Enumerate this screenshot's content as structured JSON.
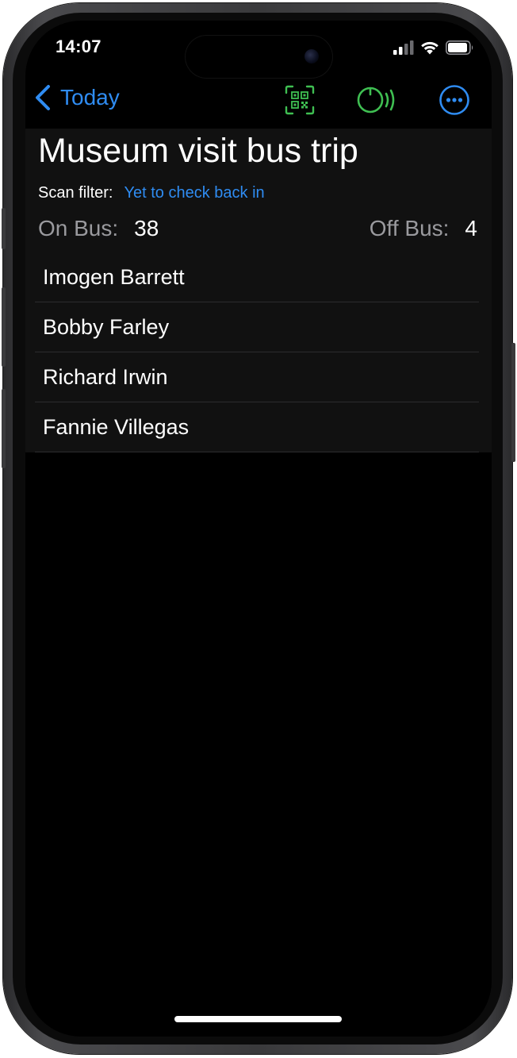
{
  "status_bar": {
    "time": "14:07"
  },
  "nav": {
    "back_label": "Today",
    "icons": [
      "chevron-left-icon",
      "qr-code-icon",
      "nfc-scan-icon",
      "more-icon"
    ],
    "colors": {
      "accent": "#2f8cf2",
      "scan": "#3fbf52"
    }
  },
  "header": {
    "title": "Museum visit bus trip",
    "filter_label": "Scan filter:",
    "filter_value": "Yet to check back in",
    "on_bus_label": "On Bus:",
    "on_bus_count": "38",
    "off_bus_label": "Off Bus:",
    "off_bus_count": "4"
  },
  "passengers": [
    {
      "name": "Imogen Barrett"
    },
    {
      "name": "Bobby Farley"
    },
    {
      "name": "Richard Irwin"
    },
    {
      "name": "Fannie Villegas"
    }
  ]
}
